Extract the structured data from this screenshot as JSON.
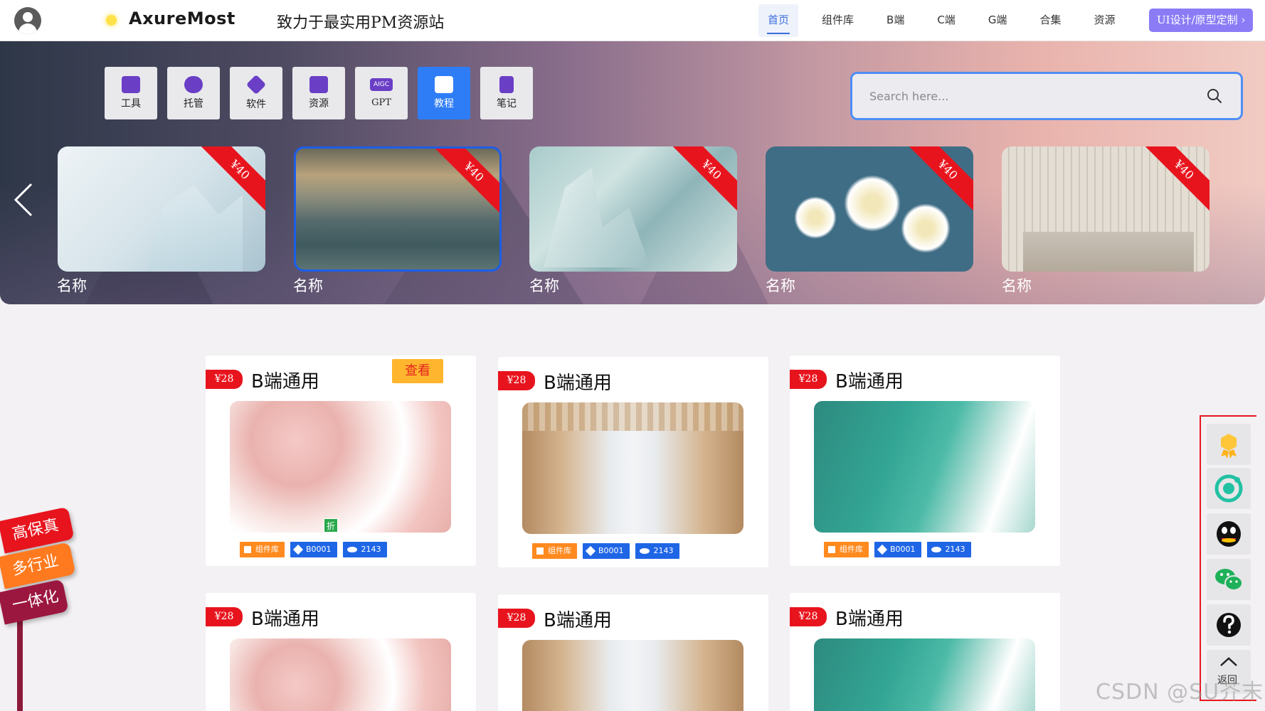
{
  "header": {
    "logo": "AxureMost",
    "slogan": "致力于最实用PM资源站",
    "nav": [
      "首页",
      "组件库",
      "B端",
      "C端",
      "G端",
      "合集",
      "资源"
    ],
    "cta": "UI设计/原型定制 ›"
  },
  "categories": [
    {
      "label": "工具",
      "icon": "briefcase-icon"
    },
    {
      "label": "托管",
      "icon": "cloud-upload-icon"
    },
    {
      "label": "软件",
      "icon": "cube-icon"
    },
    {
      "label": "资源",
      "icon": "map-pin-icon"
    },
    {
      "label": "GPT",
      "icon": "aigc-icon",
      "icon_text": "AIGC"
    },
    {
      "label": "教程",
      "icon": "book-icon"
    },
    {
      "label": "笔记",
      "icon": "notepad-icon"
    }
  ],
  "search": {
    "placeholder": "Search here..."
  },
  "slides": [
    {
      "name": "名称",
      "price": "¥40",
      "scene": "ice"
    },
    {
      "name": "名称",
      "price": "¥40",
      "scene": "beach"
    },
    {
      "name": "名称",
      "price": "¥40",
      "scene": "sculpture"
    },
    {
      "name": "名称",
      "price": "¥40",
      "scene": "daisies"
    },
    {
      "name": "名称",
      "price": "¥40",
      "scene": "bamboo"
    }
  ],
  "cards": [
    {
      "price": "¥28",
      "title": "B端通用",
      "view": "查看",
      "scene": "blossom",
      "badge": "折",
      "tags": [
        "组件库",
        "B0001",
        "2143"
      ]
    },
    {
      "price": "¥28",
      "title": "B端通用",
      "scene": "hall",
      "tags": [
        "组件库",
        "B0001",
        "2143"
      ]
    },
    {
      "price": "¥28",
      "title": "B端通用",
      "scene": "wave",
      "tags": [
        "组件库",
        "B0001",
        "2143"
      ]
    },
    {
      "price": "¥28",
      "title": "B端通用",
      "scene": "blossom"
    },
    {
      "price": "¥28",
      "title": "B端通用",
      "scene": "hall"
    },
    {
      "price": "¥28",
      "title": "B端通用",
      "scene": "wave"
    }
  ],
  "promo": [
    "高保真",
    "多行业",
    "一体化"
  ],
  "float": {
    "items": [
      "medal-icon",
      "ring-icon",
      "qq-icon",
      "wechat-icon",
      "help-icon",
      "back-top-icon"
    ],
    "back_label": "返回"
  },
  "watermark": "CSDN @SU芥末",
  "colors": {
    "accent": "#2f7df6",
    "price_red": "#e8141d",
    "cta_purple": "#8b7cf6",
    "tag_orange": "#ff8a1f",
    "tag_blue": "#1f66e6",
    "view_yellow": "#ffb52e"
  }
}
